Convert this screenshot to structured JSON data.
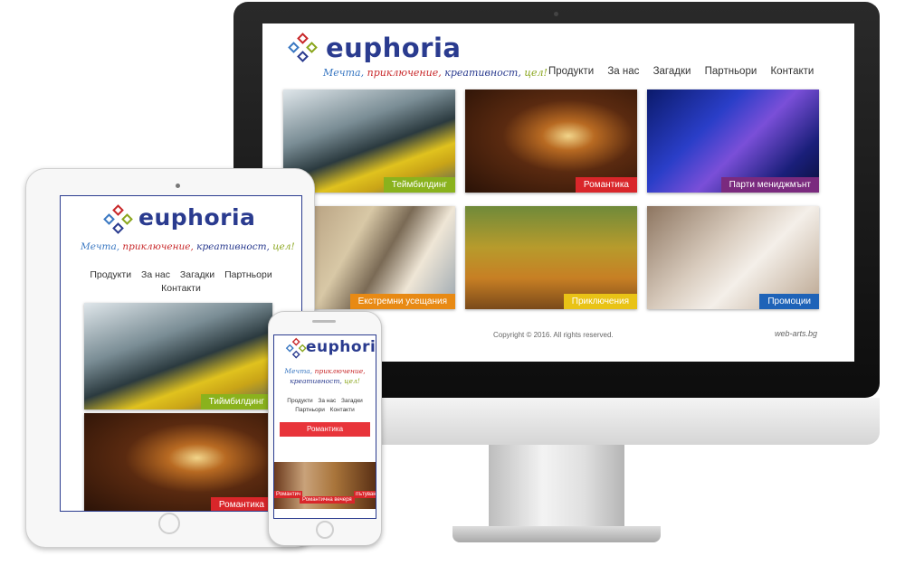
{
  "brand": {
    "logo_text": "euphoria",
    "tagline": [
      "Мечта,",
      "приключение,",
      "креативност,",
      "цел!"
    ],
    "tagline_colors": [
      "#3a78c2",
      "#c8282a",
      "#2a3b8f",
      "#8aa61d"
    ],
    "diamond_colors": [
      "#c8282a",
      "#3a78c2",
      "#8aa61d",
      "#2a3b8f"
    ]
  },
  "nav": {
    "items": [
      "Продукти",
      "За нас",
      "Загадки",
      "Партньори",
      "Контакти"
    ]
  },
  "tiles": [
    {
      "label": "Теймбилдинг",
      "color": "#8ab21d",
      "icon": "rafting-photo"
    },
    {
      "label": "Романтика",
      "color": "#d9262a",
      "icon": "candles-photo"
    },
    {
      "label": "Парти мениджмънт",
      "color": "#7a2a7e",
      "icon": "dj-mixer-photo"
    },
    {
      "label": "Екстремни усещания",
      "color": "#e88a14",
      "icon": "climber-photo"
    },
    {
      "label": "Приключения",
      "color": "#e9c316",
      "icon": "signpost-photo"
    },
    {
      "label": "Промоции",
      "color": "#1e63b8",
      "icon": "phone-coffee-photo"
    }
  ],
  "footer": {
    "copyright": "Copyright © 2016. All rights reserved.",
    "credit": "web-arts.bg"
  },
  "ipad": {
    "tiles": [
      {
        "label": "Тиймбилдинг",
        "color": "#8ab21d"
      },
      {
        "label": "Романтика",
        "color": "#d9262a"
      }
    ]
  },
  "iphone": {
    "banner": "Романтика",
    "banner_color": "#e8343a",
    "card_left": "Романтич",
    "card_center": "Романтична вечеря",
    "card_right": "пътуванд"
  }
}
